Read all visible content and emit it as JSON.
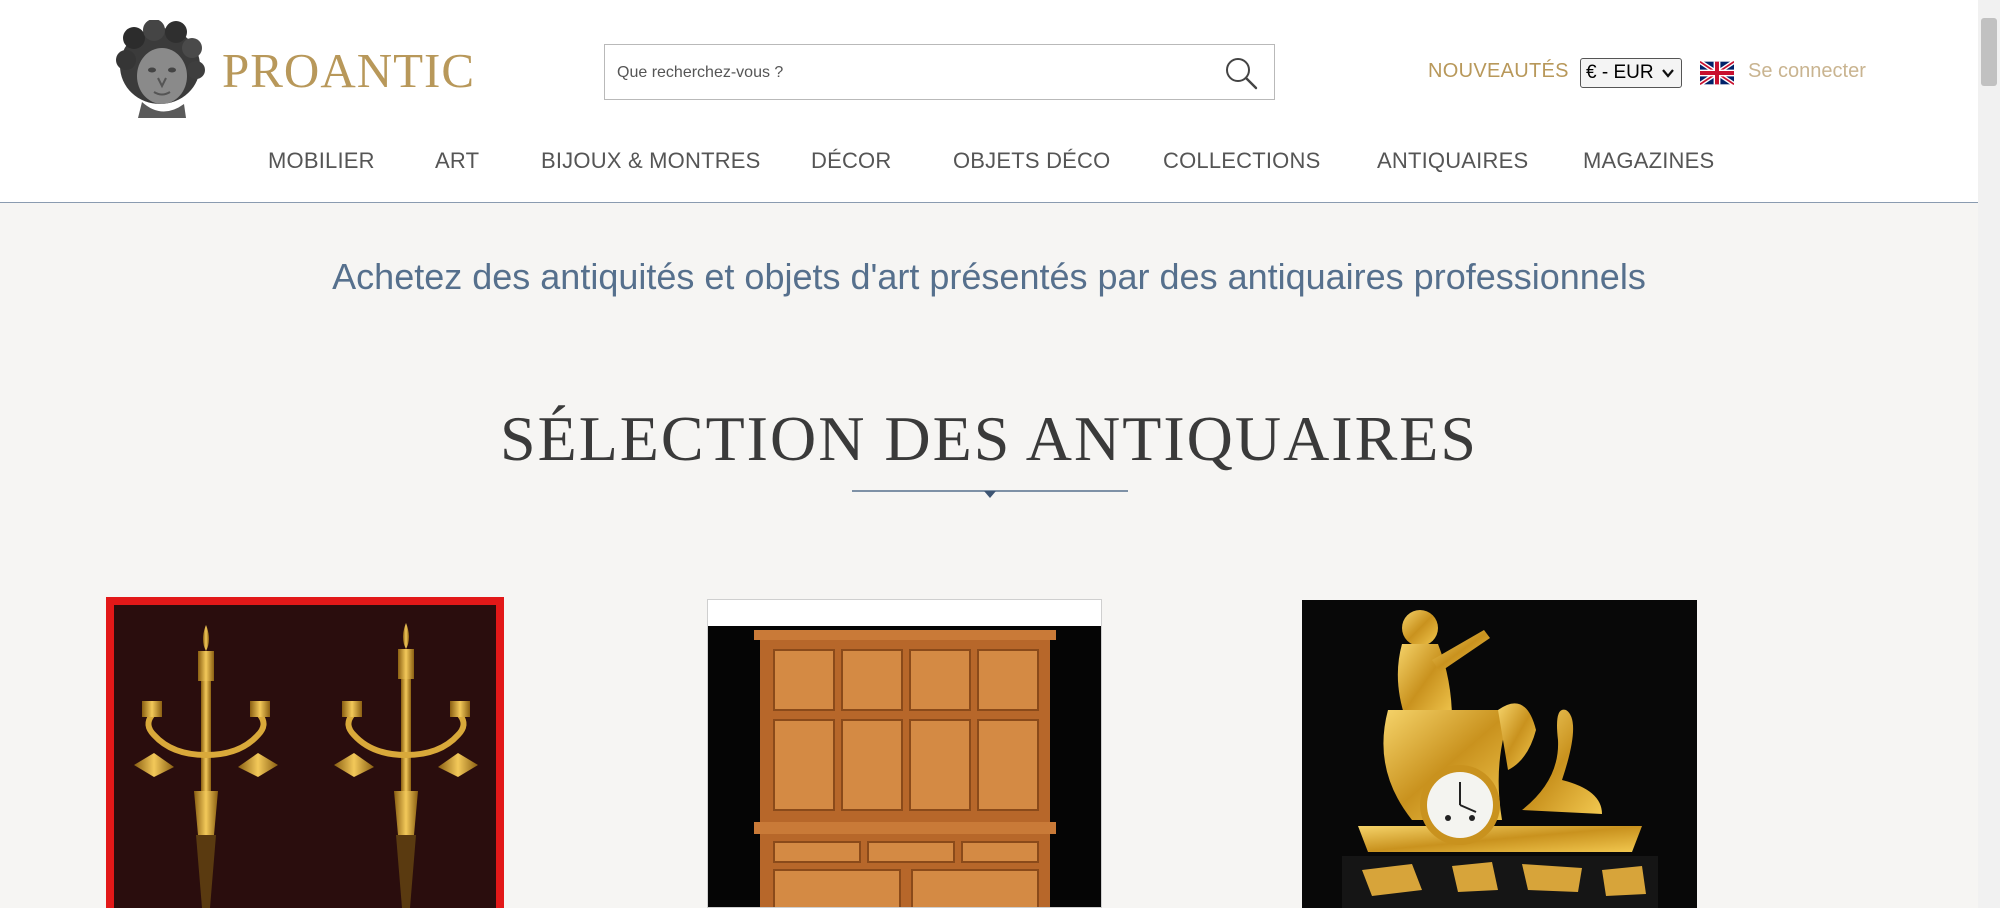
{
  "brand": {
    "name": "PROANTIC"
  },
  "search": {
    "placeholder": "Que recherchez-vous ?"
  },
  "header": {
    "new_label": "NOUVEAUTÉS",
    "currency": "€ - EUR",
    "login_label": "Se connecter",
    "flag_icon": "uk-flag-icon"
  },
  "nav": {
    "items": [
      {
        "label": "MOBILIER"
      },
      {
        "label": "ART"
      },
      {
        "label": "BIJOUX & MONTRES"
      },
      {
        "label": "DÉCOR"
      },
      {
        "label": "OBJETS DÉCO"
      },
      {
        "label": "COLLECTIONS"
      },
      {
        "label": "ANTIQUAIRES"
      },
      {
        "label": "MAGAZINES"
      }
    ]
  },
  "main": {
    "tagline": "Achetez des antiquités et objets d'art présentés par des antiquaires professionnels",
    "section_title": "SÉLECTION DES ANTIQUAIRES"
  },
  "colors": {
    "brand_gold": "#b8985a",
    "tagline_blue": "#56708d",
    "selected_border": "#e21818",
    "background": "#f6f5f3"
  }
}
